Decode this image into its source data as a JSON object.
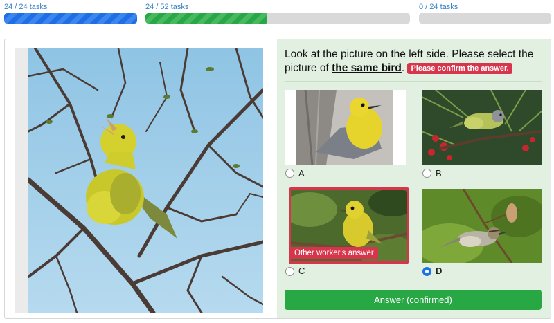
{
  "progress": [
    {
      "label": "24 / 24 tasks",
      "fraction": 1.0
    },
    {
      "label": "24 / 52 tasks",
      "fraction": 0.4615
    },
    {
      "label": "0 / 24 tasks",
      "fraction": 0.0
    }
  ],
  "question": {
    "text_before": "Look at the picture on the left side. Please select the picture of ",
    "emphasis": "the same bird",
    "text_after": ".",
    "badge": "Please confirm the answer."
  },
  "options": [
    {
      "label": "A",
      "selected": false
    },
    {
      "label": "B",
      "selected": false
    },
    {
      "label": "C",
      "selected": false,
      "badge": "Other worker's answer"
    },
    {
      "label": "D",
      "selected": true
    }
  ],
  "answer_button": "Answer (confirmed)",
  "colors": {
    "accent_blue": "#1e6fe6",
    "success_green": "#28a745",
    "alert_red": "#d7354b",
    "panel_green": "#e1f0e1"
  }
}
